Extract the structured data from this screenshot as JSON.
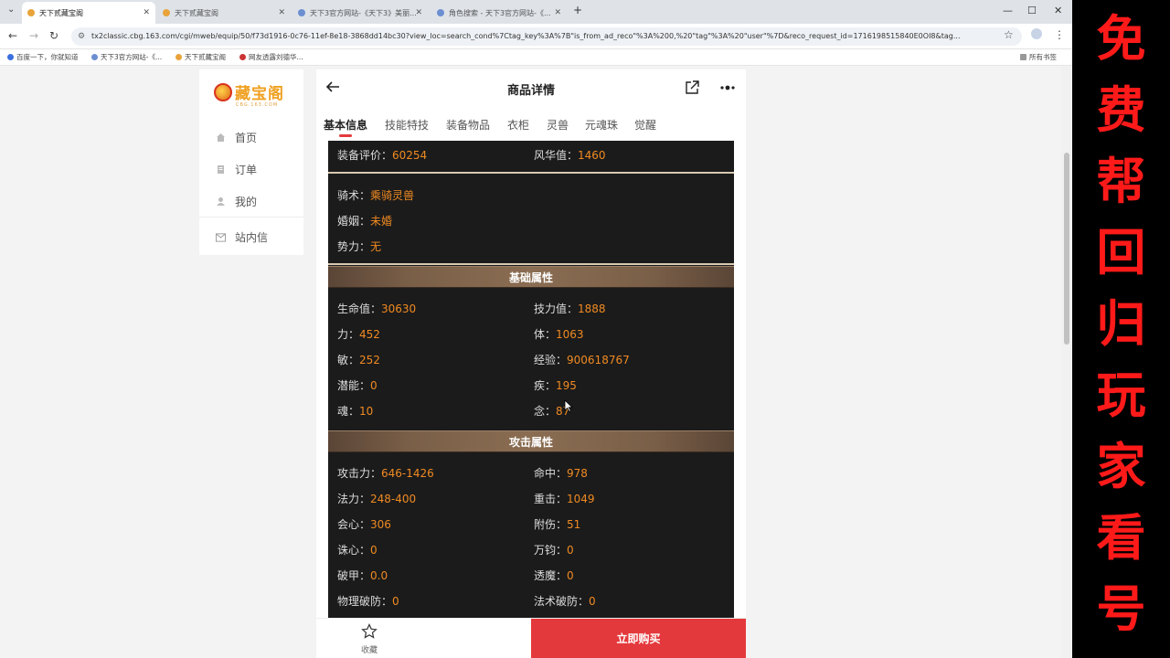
{
  "browser": {
    "tabs": [
      {
        "label": "天下贰藏宝阁"
      },
      {
        "label": "天下贰藏宝阁"
      },
      {
        "label": "天下3官方网站-《天下3》美丽..."
      },
      {
        "label": "角色搜索 - 天下3官方网站-《..."
      }
    ],
    "url": "tx2classic.cbg.163.com/cgi/mweb/equip/50/f73d1916-0c76-11ef-8e18-3868dd14bc30?view_loc=search_cond%7Ctag_key%3A%7B\"is_from_ad_reco\"%3A%200,%20\"tag\"%3A%20\"user\"%7D&reco_request_id=1716198515840E0OI8&tag...",
    "bookmarks": [
      "百度一下，你就知道",
      "天下3官方网站-《...",
      "天下贰藏宝阁",
      "网友透露刘德华..."
    ],
    "bookmarks_right": "所有书签"
  },
  "leftnav": {
    "logo": "藏宝阁",
    "logo_sub": "CBG.163.COM",
    "items": [
      {
        "label": "首页",
        "icon": "home-icon"
      },
      {
        "label": "订单",
        "icon": "order-icon"
      },
      {
        "label": "我的",
        "icon": "user-icon"
      },
      {
        "label": "站内信",
        "icon": "mail-icon"
      }
    ]
  },
  "page": {
    "title": "商品详情",
    "tabs": [
      "基本信息",
      "技能特技",
      "装备物品",
      "衣柜",
      "灵兽",
      "元魂珠",
      "觉醒"
    ],
    "active_tab": "基本信息"
  },
  "top_stats": [
    {
      "label": "装备评价：",
      "value": "60254"
    },
    {
      "label": "风华值：",
      "value": "1460"
    }
  ],
  "misc": [
    {
      "label": "骑术：",
      "value": "乘骑灵兽"
    },
    {
      "label": "婚姻：",
      "value": "未婚"
    },
    {
      "label": "势力：",
      "value": "无"
    }
  ],
  "basic": {
    "title": "基础属性",
    "items": [
      {
        "label": "生命值：",
        "value": "30630"
      },
      {
        "label": "技力值：",
        "value": "1888"
      },
      {
        "label": "力：",
        "value": "452"
      },
      {
        "label": "体：",
        "value": "1063"
      },
      {
        "label": "敏：",
        "value": "252"
      },
      {
        "label": "经验：",
        "value": "900618767"
      },
      {
        "label": "潜能：",
        "value": "0"
      },
      {
        "label": "疾：",
        "value": "195"
      },
      {
        "label": "魂：",
        "value": "10"
      },
      {
        "label": "念：",
        "value": "87"
      }
    ]
  },
  "attack": {
    "title": "攻击属性",
    "items": [
      {
        "label": "攻击力：",
        "value": "646-1426"
      },
      {
        "label": "命中：",
        "value": "978"
      },
      {
        "label": "法力：",
        "value": "248-400"
      },
      {
        "label": "重击：",
        "value": "1049"
      },
      {
        "label": "会心：",
        "value": "306"
      },
      {
        "label": "附伤：",
        "value": "51"
      },
      {
        "label": "诛心：",
        "value": "0"
      },
      {
        "label": "万钧：",
        "value": "0"
      },
      {
        "label": "破甲：",
        "value": "0.0"
      },
      {
        "label": "透魔：",
        "value": "0"
      },
      {
        "label": "物理破防：",
        "value": "0"
      },
      {
        "label": "法术破防：",
        "value": "0"
      }
    ]
  },
  "bottom": {
    "fav_label": "收藏",
    "buy_label": "立即购买"
  },
  "promo": {
    "chars": [
      "免",
      "费",
      "帮",
      "回",
      "归",
      "玩",
      "家",
      "看",
      "号"
    ],
    "color": "#ff1a1a"
  },
  "colors": {
    "accent": "#e4393c",
    "value": "#f08a22",
    "panel_bg": "#1b1b1b"
  }
}
